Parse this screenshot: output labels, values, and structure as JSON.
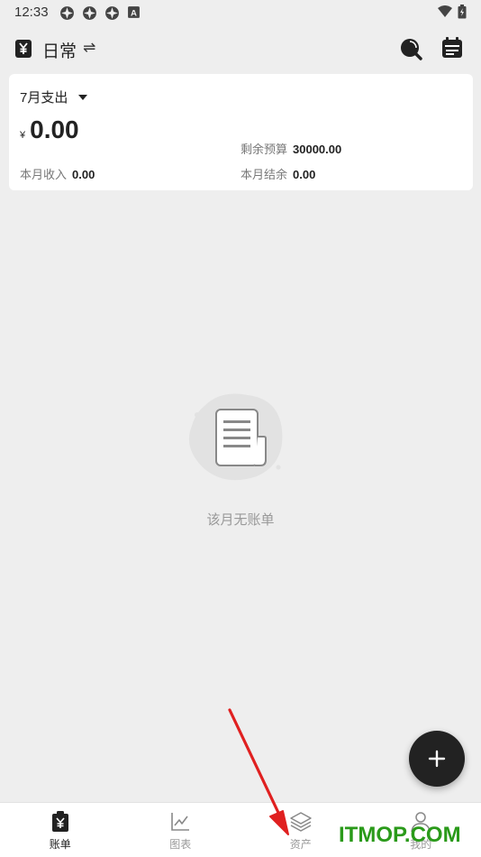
{
  "status_bar": {
    "time": "12:33",
    "icons": [
      "app-notification-icon",
      "app-notification-icon",
      "app-notification-icon",
      "a-badge-icon"
    ],
    "badge_letter": "A",
    "right_icons": [
      "wifi-icon",
      "battery-icon"
    ]
  },
  "header": {
    "book_icon": "yen-book-icon",
    "book_title": "日常",
    "swap_symbol": "⇌"
  },
  "summary": {
    "month_label": "7月支出",
    "currency": "¥",
    "expense": "0.00",
    "budget_left_label": "剩余预算",
    "budget_left_value": "30000.00",
    "income_label": "本月收入",
    "income_value": "0.00",
    "balance_label": "本月结余",
    "balance_value": "0.00"
  },
  "empty": {
    "message": "该月无账单"
  },
  "fab": {
    "symbol": "+"
  },
  "nav": {
    "items": [
      {
        "label": "账单",
        "icon": "bill-icon",
        "active": true
      },
      {
        "label": "图表",
        "icon": "chart-icon",
        "active": false
      },
      {
        "label": "资产",
        "icon": "layers-icon",
        "active": false
      },
      {
        "label": "我的",
        "icon": "user-icon",
        "active": false
      }
    ]
  },
  "watermark": "ITMOP.COM",
  "colors": {
    "background": "#eeeeee",
    "card": "#ffffff",
    "text_primary": "#222222",
    "text_muted": "#999999",
    "fab": "#222222",
    "watermark": "#2a9a1a",
    "annotation_arrow": "#e02020"
  }
}
